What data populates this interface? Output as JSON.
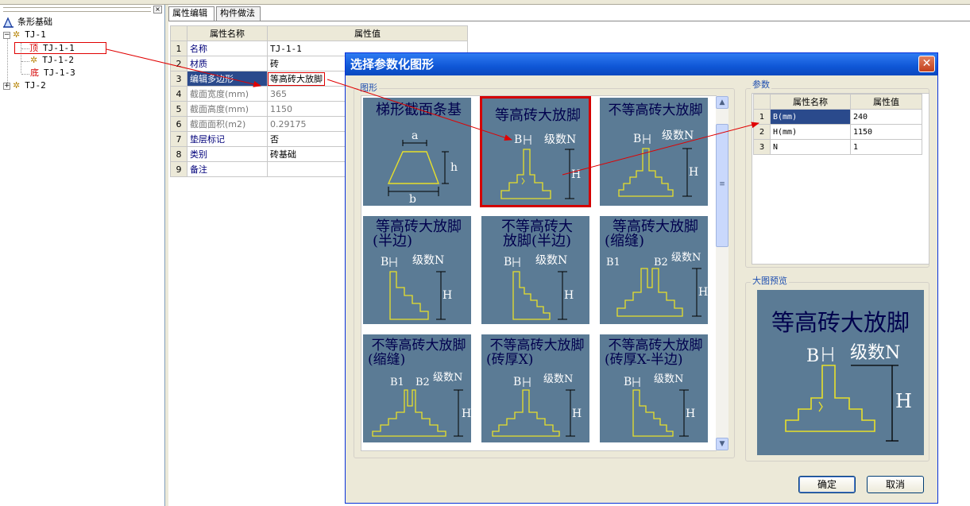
{
  "tree": {
    "root_label": "条形基础",
    "nodes": [
      {
        "label": "TJ-1"
      },
      {
        "prefix": "顶",
        "label": "TJ-1-1"
      },
      {
        "label": "TJ-1-2"
      },
      {
        "prefix": "底",
        "label": "TJ-1-3"
      },
      {
        "label": "TJ-2"
      }
    ],
    "expand_minus": "−",
    "expand_plus": "+",
    "close_glyph": "×"
  },
  "tabs": [
    "属性编辑",
    "构件做法"
  ],
  "property_table": {
    "headers": [
      "属性名称",
      "属性值"
    ],
    "rows": [
      {
        "num": "1",
        "name": "名称",
        "value": "TJ-1-1"
      },
      {
        "num": "2",
        "name": "材质",
        "value": "砖"
      },
      {
        "num": "3",
        "name": "编辑多边形",
        "value": "等高砖大放脚"
      },
      {
        "num": "4",
        "name": "截面宽度(mm)",
        "value": "365"
      },
      {
        "num": "5",
        "name": "截面高度(mm)",
        "value": "1150"
      },
      {
        "num": "6",
        "name": "截面面积(m2)",
        "value": "0.29175"
      },
      {
        "num": "7",
        "name": "垫层标记",
        "value": "否"
      },
      {
        "num": "8",
        "name": "类别",
        "value": "砖基础"
      },
      {
        "num": "9",
        "name": "备注",
        "value": ""
      }
    ]
  },
  "dialog": {
    "title": "选择参数化图形",
    "close_glyph": "✕",
    "gallery_label": "图形",
    "params_label": "参数",
    "preview_label": "大图预览",
    "ok_label": "确定",
    "cancel_label": "取消",
    "scroll_up": "▲",
    "scroll_down": "▼",
    "scroll_grip": "≡",
    "shapes": [
      {
        "title1": "梯形截面条基",
        "title2": "",
        "a": "a",
        "h": "h",
        "b": "b"
      },
      {
        "title1": "等高砖大放脚",
        "title2": "",
        "B": "B",
        "N": "级数N",
        "H": "H"
      },
      {
        "title1": "不等高砖大放脚",
        "title2": "",
        "B": "B",
        "N": "级数N",
        "H": "H"
      },
      {
        "title1": "等高砖大放脚",
        "title2": "(半边)",
        "B": "B",
        "N": "级数N",
        "H": "H"
      },
      {
        "title1": "不等高砖大",
        "title2": "放脚(半边)",
        "B": "B",
        "N": "级数N",
        "H": "H"
      },
      {
        "title1": "等高砖大放脚",
        "title2": "(缩缝)",
        "B": "B1",
        "B2": "B2",
        "N": "级数N",
        "H": "H"
      },
      {
        "title1": "不等高砖大放脚",
        "title2": "(缩缝)",
        "B": "B1",
        "B2": "B2",
        "N": "级数N",
        "H": "H"
      },
      {
        "title1": "不等高砖大放脚",
        "title2": "(砖厚X)",
        "B": "B",
        "N": "级数N",
        "H": "H"
      },
      {
        "title1": "不等高砖大放脚",
        "title2": "(砖厚X-半边)",
        "B": "B",
        "N": "级数N",
        "H": "H"
      }
    ],
    "param_table": {
      "headers": [
        "属性名称",
        "属性值"
      ],
      "rows": [
        {
          "num": "1",
          "name": "B(mm)",
          "value": "240"
        },
        {
          "num": "2",
          "name": "H(mm)",
          "value": "1150"
        },
        {
          "num": "3",
          "name": "N",
          "value": "1"
        }
      ]
    },
    "preview": {
      "title": "等高砖大放脚",
      "B": "B",
      "N": "级数N",
      "H": "H"
    }
  },
  "colors": {
    "tile_bg": "#5b7b95",
    "tile_title": "#00004d",
    "shape_line": "#e8e02a",
    "highlight": "#d40000",
    "title_bar": "#0f56d6"
  }
}
